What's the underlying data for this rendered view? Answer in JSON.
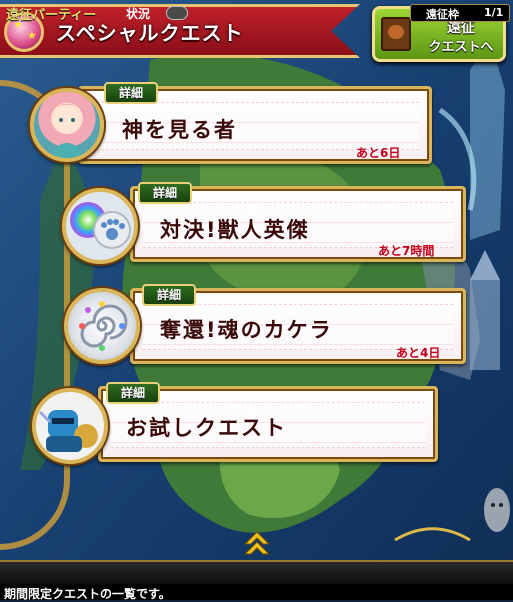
{
  "header": {
    "title": "スペシャルクエスト",
    "expedition_button": {
      "line1": "遠征",
      "line2": "クエストへ"
    }
  },
  "quests": [
    {
      "detail_label": "詳細",
      "name": "神を見る者",
      "time_left": "あと6日",
      "avatar_icon": "goddess-portrait-icon"
    },
    {
      "detail_label": "詳細",
      "name": "対決!獣人英傑",
      "time_left": "あと7時間",
      "avatar_icon": "beast-orb-icon"
    },
    {
      "detail_label": "詳細",
      "name": "奪還!魂のカケラ",
      "time_left": "あと4日",
      "avatar_icon": "spiral-soul-orb-icon"
    },
    {
      "detail_label": "詳細",
      "name": "お試しクエスト",
      "time_left": "",
      "avatar_icon": "armored-knight-icon"
    }
  ],
  "bottom_bar": {
    "party_label": "遠征パーティー",
    "status_label": "状況",
    "slot_label": "遠征枠",
    "slot_count": "1/1"
  },
  "message": "期間限定クエストの一覧です。",
  "colors": {
    "header_red": "#c0202a",
    "gold_border": "#d8b45a",
    "detail_tab_green": "#2f6c20",
    "expedition_green": "#7db824",
    "time_red": "#c5001c"
  }
}
